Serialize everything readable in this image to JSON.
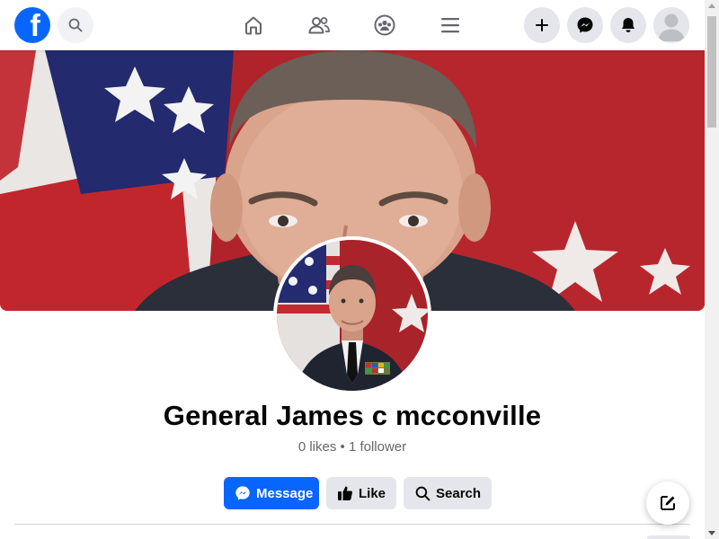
{
  "topbar": {
    "logo_letter": "f",
    "icons": {
      "logo": "facebook-logo",
      "search": "search-icon",
      "home": "home-icon",
      "friends": "friends-icon",
      "groups": "groups-icon",
      "menu": "menu-icon",
      "create": "plus-icon",
      "messenger": "messenger-icon",
      "notifications": "bell-icon",
      "account": "avatar-icon"
    }
  },
  "profile": {
    "name": "General James c mcconville",
    "stats": "0 likes • 1 follower"
  },
  "actions": {
    "message_label": "Message",
    "like_label": "Like",
    "search_label": "Search"
  },
  "colors": {
    "brand": "#0866ff",
    "secondary_button": "#e4e6eb",
    "text_primary": "#050505",
    "text_secondary": "#65676b"
  }
}
